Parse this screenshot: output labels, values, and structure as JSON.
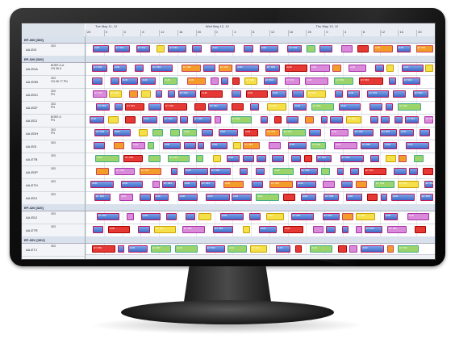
{
  "header": {
    "days": [
      "Tue May 11, 12",
      "Wed May 12, 12",
      "Thu May 13, 12"
    ],
    "hours": [
      "20",
      "0",
      "4",
      "8",
      "12",
      "16",
      "20",
      "0",
      "4",
      "8",
      "12",
      "16",
      "20",
      "0",
      "4",
      "8",
      "12",
      "16",
      "20"
    ]
  },
  "groups": [
    {
      "id": "g1",
      "label": "EP-300 [309]",
      "rows": [
        {
          "label": "AA-EID",
          "info": [
            "303"
          ]
        }
      ]
    },
    {
      "id": "g2",
      "label": "EP-320 [320]",
      "rows": [
        {
          "label": "AA-EDA",
          "info": [
            "BOEE A-A",
            "CN 36 A"
          ]
        },
        {
          "label": "AA-EDB",
          "info": [
            "303",
            "CN 36 77 PN"
          ]
        },
        {
          "label": "AA-EDC",
          "info": [
            "303",
            "PN"
          ]
        },
        {
          "label": "AA-EDF",
          "info": [
            "303",
            "PN"
          ]
        },
        {
          "label": "AA-EDJ",
          "info": [
            "BOEE A",
            "PN"
          ]
        },
        {
          "label": "AA-EDH",
          "info": [
            "303",
            "PN"
          ]
        },
        {
          "label": "AA-EDI",
          "info": [
            "303"
          ]
        },
        {
          "label": "AA-ETB",
          "info": [
            "303"
          ]
        },
        {
          "label": "AA-EDP",
          "info": [
            "303"
          ]
        },
        {
          "label": "AA-ETH",
          "info": [
            "303"
          ]
        },
        {
          "label": "AA-EDJ",
          "info": [
            "303"
          ]
        }
      ]
    },
    {
      "id": "g3",
      "label": "EP-320 [320]",
      "rows": [
        {
          "label": "AA-EDJ",
          "info": [
            "303"
          ]
        },
        {
          "label": "AA-ETR",
          "info": [
            "303"
          ]
        }
      ]
    },
    {
      "id": "g4",
      "label": "EP-3SV [3SV]",
      "rows": [
        {
          "label": "AA-ETJ",
          "info": [
            "303"
          ]
        }
      ]
    }
  ],
  "bar_labels": [
    "AUR",
    "EY 063",
    "1250",
    "2038",
    "Maintenance",
    "A-Check"
  ],
  "colors": {
    "blue": "#3f69c7",
    "yellow": "#f5e04a",
    "red": "#e53935",
    "orange": "#f39c2a",
    "border": "#c2185b",
    "group_bg": "#d9e1ec"
  }
}
